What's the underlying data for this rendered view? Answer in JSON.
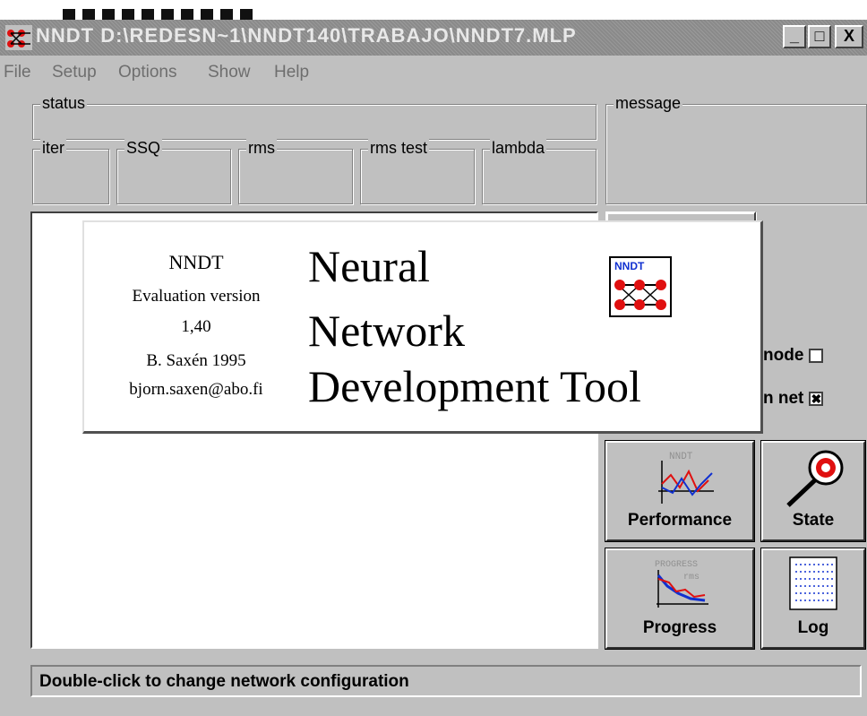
{
  "window": {
    "title": "NNDT  D:\\REDESN~1\\NNDT140\\TRABAJO\\NNDT7.MLP",
    "controls": {
      "minimize": "_",
      "maximize": "□",
      "close": "X"
    }
  },
  "menu": [
    "File",
    "Setup",
    "Options",
    "Show",
    "Help"
  ],
  "groups": {
    "status": "status",
    "message": "message",
    "iter": "iter",
    "ssq": "SSQ",
    "rms": "rms",
    "rms_test": "rms test",
    "lambda": "lambda"
  },
  "splash": {
    "product": "NNDT",
    "edition": "Evaluation version",
    "version": "1,40",
    "author": "B. Saxén 1995",
    "email": "bjorn.saxen@abo.fi",
    "line1": "Neural",
    "line2": "Network",
    "line3": "Development Tool",
    "logo_text": "NNDT"
  },
  "options": {
    "mode_label": "node",
    "mode_checked": false,
    "net_label": "n net",
    "net_checked": true,
    "check_mark": "✖"
  },
  "buttons": {
    "performance": "Performance",
    "performance_icon_text": "NNDT",
    "state": "State",
    "progress": "Progress",
    "progress_icon_text": "PROGRESS",
    "progress_icon_sub": "rms",
    "log": "Log"
  },
  "status_bar": "Double-click to change network configuration",
  "colors": {
    "accent_red": "#e01010",
    "accent_blue": "#1030d0"
  }
}
